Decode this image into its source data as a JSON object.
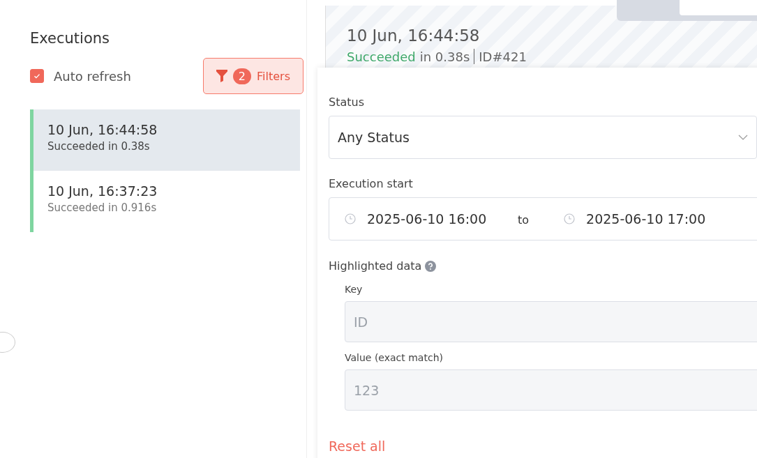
{
  "sidebar": {
    "title": "Executions",
    "auto_refresh": {
      "label": "Auto refresh",
      "checked": true
    },
    "filters_button": {
      "count": "2",
      "label": "Filters",
      "active": true
    },
    "executions": [
      {
        "time": "10 Jun, 16:44:58",
        "status": "Succeeded in 0.38s",
        "selected": true,
        "color": "#7fd5a0"
      },
      {
        "time": "10 Jun, 16:37:23",
        "status": "Succeeded in 0.916s",
        "selected": false,
        "color": "#7fd5a0"
      }
    ]
  },
  "detail": {
    "time": "10 Jun, 16:44:58",
    "status": "Succeeded",
    "duration": "in 0.38s",
    "id": "ID#421"
  },
  "filters": {
    "status_label": "Status",
    "status_value": "Any Status",
    "start_label": "Execution start",
    "start_from": "2025-06-10 16:00",
    "range_separator": "to",
    "start_to": "2025-06-10 17:00",
    "highlighted_label": "Highlighted data",
    "key_label": "Key",
    "key_placeholder": "ID",
    "value_label": "Value (exact match)",
    "value_placeholder": "123",
    "reset": "Reset all"
  }
}
